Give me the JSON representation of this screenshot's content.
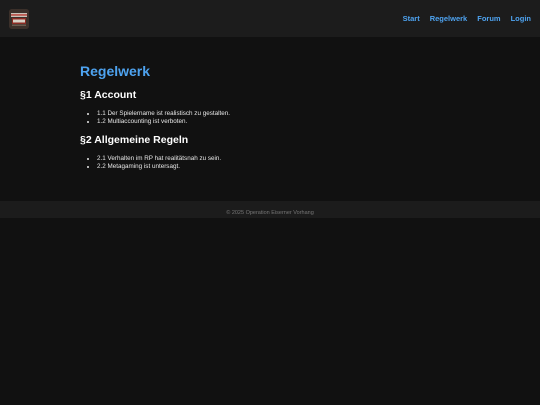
{
  "header": {
    "logo_icon": "clapperboard-logo-icon",
    "nav": [
      {
        "label": "Start"
      },
      {
        "label": "Regelwerk"
      },
      {
        "label": "Forum"
      },
      {
        "label": "Login"
      }
    ]
  },
  "main": {
    "title": "Regelwerk",
    "sections": [
      {
        "heading": "§1 Account",
        "rules": [
          "1.1 Der Spielername ist realistisch zu gestalten.",
          "1.2 Multiaccounting ist verboten."
        ]
      },
      {
        "heading": "§2 Allgemeine Regeln",
        "rules": [
          "2.1 Verhalten im RP hat realitätsnah zu sein.",
          "2.2 Metagaming ist untersagt."
        ]
      }
    ]
  },
  "footer": {
    "text": "© 2025 Operation Eiserner Vorhang"
  },
  "colors": {
    "accent": "#4ea3f0",
    "background": "#111111",
    "header_bg": "#1c1c1c"
  }
}
